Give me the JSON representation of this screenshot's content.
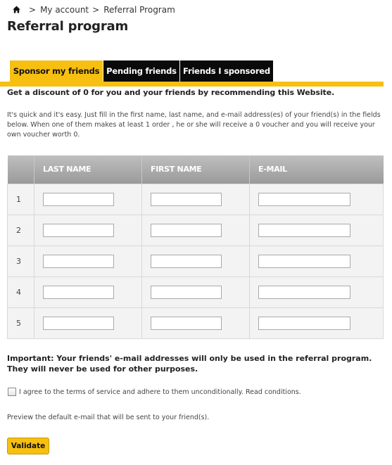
{
  "breadcrumb": {
    "home_icon": "home-icon",
    "separator": ">",
    "my_account": "My account",
    "current": "Referral Program"
  },
  "page": {
    "title": "Referral program"
  },
  "tabs": [
    {
      "label": "Sponsor my friends",
      "active": true
    },
    {
      "label": "Pending friends",
      "active": false
    },
    {
      "label": "Friends I sponsored",
      "active": false
    }
  ],
  "content": {
    "discount_text": "Get a discount of 0 for you and your friends by recommending this Website.",
    "intro_text": "It's quick and it's easy. Just fill in the first name, last name, and e-mail address(es) of your friend(s) in the fields below. When one of them makes at least 1 order , he or she will receive a 0 voucher and you will receive your own voucher worth 0."
  },
  "table": {
    "headers": [
      "LAST NAME",
      "FIRST NAME",
      "E-MAIL"
    ],
    "rows": [
      {
        "index": "1",
        "last_name": "",
        "first_name": "",
        "email": ""
      },
      {
        "index": "2",
        "last_name": "",
        "first_name": "",
        "email": ""
      },
      {
        "index": "3",
        "last_name": "",
        "first_name": "",
        "email": ""
      },
      {
        "index": "4",
        "last_name": "",
        "first_name": "",
        "email": ""
      },
      {
        "index": "5",
        "last_name": "",
        "first_name": "",
        "email": ""
      }
    ]
  },
  "important_text": "Important: Your friends' e-mail addresses will only be used in the referral program. They will never be used for other purposes.",
  "agree": {
    "checked": false,
    "text": "I agree to the terms of service and adhere to them unconditionally. Read conditions."
  },
  "preview_text": "Preview the default e-mail that will be sent to your friend(s).",
  "validate_label": "Validate",
  "colors": {
    "accent": "#f7bf10",
    "tab_dark": "#0a0a0a",
    "table_header": "#aaaaaa"
  }
}
